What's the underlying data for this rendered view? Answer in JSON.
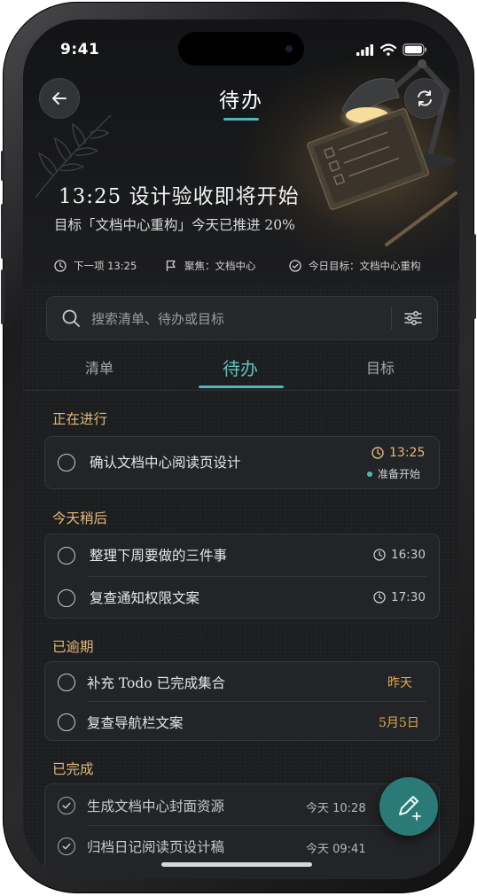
{
  "status_bar": {
    "time": "9:41"
  },
  "header": {
    "title": "待办"
  },
  "hero": {
    "headline": "13:25 设计验收即将开始",
    "subline": "目标「文档中心重构」今天已推进 20%",
    "meta": {
      "next": "下一项 13:25",
      "focus": "聚焦：文档中心",
      "goal": "今日目标：文档中心重构"
    }
  },
  "search": {
    "placeholder": "搜索清单、待办或目标"
  },
  "tabs": [
    {
      "label": "清单",
      "active": false
    },
    {
      "label": "待办",
      "active": true
    },
    {
      "label": "目标",
      "active": false
    }
  ],
  "sections": {
    "in_progress": {
      "title": "正在进行",
      "items": [
        {
          "label": "确认文档中心阅读页设计",
          "time": "13:25",
          "status": "准备开始"
        }
      ]
    },
    "later_today": {
      "title": "今天稍后",
      "items": [
        {
          "label": "整理下周要做的三件事",
          "time": "16:30"
        },
        {
          "label": "复查通知权限文案",
          "time": "17:30"
        }
      ]
    },
    "overdue": {
      "title": "已逾期",
      "items": [
        {
          "label": "补充 Todo 已完成集合",
          "due": "昨天"
        },
        {
          "label": "复查导航栏文案",
          "due": "5月5日"
        }
      ]
    },
    "completed": {
      "title": "已完成",
      "items": [
        {
          "label": "生成文档中心封面资源",
          "time": "今天 10:28"
        },
        {
          "label": "归档日记阅读页设计稿",
          "time": "今天 09:41"
        }
      ]
    }
  },
  "colors": {
    "accent": "#4fb8b4",
    "warm": "#e2b97a",
    "overdue": "#e0a94e",
    "fab": "#2a7b77"
  }
}
